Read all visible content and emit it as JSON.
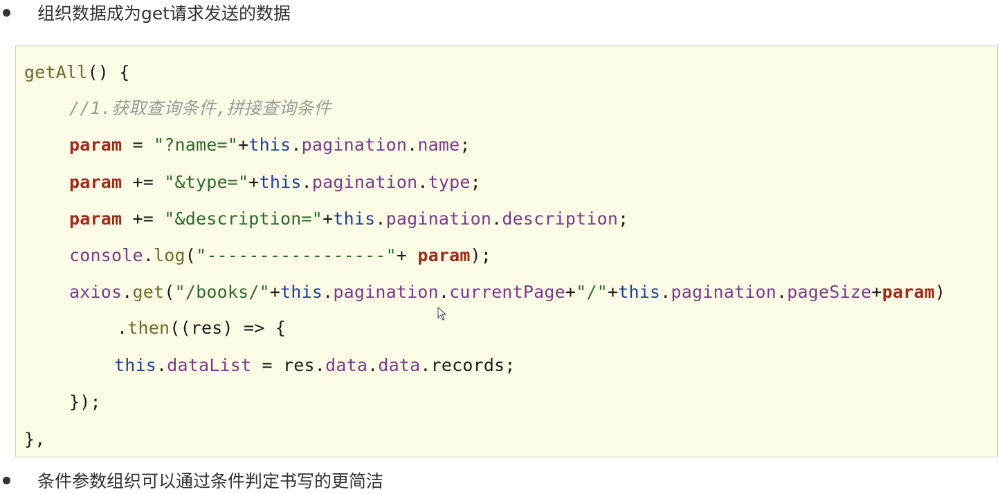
{
  "bullets": [
    {
      "text": "组织数据成为get请求发送的数据"
    },
    {
      "text": "条件参数组织可以通过条件判定书写的更简洁"
    }
  ],
  "code": {
    "lines": [
      [
        {
          "t": "fn",
          "v": "getAll"
        },
        {
          "t": "plain",
          "v": "() {"
        }
      ],
      [
        {
          "t": "comment",
          "v": "//1.获取查询条件,拼接查询条件"
        }
      ],
      [
        {
          "t": "var",
          "v": "param"
        },
        {
          "t": "plain",
          "v": " = "
        },
        {
          "t": "str",
          "v": "\"?name=\""
        },
        {
          "t": "plain",
          "v": "+"
        },
        {
          "t": "kw",
          "v": "this"
        },
        {
          "t": "plain",
          "v": "."
        },
        {
          "t": "prop",
          "v": "pagination"
        },
        {
          "t": "plain",
          "v": "."
        },
        {
          "t": "prop",
          "v": "name"
        },
        {
          "t": "plain",
          "v": ";"
        }
      ],
      [
        {
          "t": "var",
          "v": "param"
        },
        {
          "t": "plain",
          "v": " += "
        },
        {
          "t": "str",
          "v": "\"&type=\""
        },
        {
          "t": "plain",
          "v": "+"
        },
        {
          "t": "kw",
          "v": "this"
        },
        {
          "t": "plain",
          "v": "."
        },
        {
          "t": "prop",
          "v": "pagination"
        },
        {
          "t": "plain",
          "v": "."
        },
        {
          "t": "prop",
          "v": "type"
        },
        {
          "t": "plain",
          "v": ";"
        }
      ],
      [
        {
          "t": "var",
          "v": "param"
        },
        {
          "t": "plain",
          "v": " += "
        },
        {
          "t": "str",
          "v": "\"&description=\""
        },
        {
          "t": "plain",
          "v": "+"
        },
        {
          "t": "kw",
          "v": "this"
        },
        {
          "t": "plain",
          "v": "."
        },
        {
          "t": "prop",
          "v": "pagination"
        },
        {
          "t": "plain",
          "v": "."
        },
        {
          "t": "prop",
          "v": "description"
        },
        {
          "t": "plain",
          "v": ";"
        }
      ],
      [
        {
          "t": "prop",
          "v": "console"
        },
        {
          "t": "plain",
          "v": "."
        },
        {
          "t": "fn",
          "v": "log"
        },
        {
          "t": "plain",
          "v": "("
        },
        {
          "t": "str",
          "v": "\"-----------------\""
        },
        {
          "t": "plain",
          "v": "+ "
        },
        {
          "t": "var",
          "v": "param"
        },
        {
          "t": "plain",
          "v": ");"
        }
      ],
      [
        {
          "t": "prop",
          "v": "axios"
        },
        {
          "t": "plain",
          "v": "."
        },
        {
          "t": "fn",
          "v": "get"
        },
        {
          "t": "plain",
          "v": "("
        },
        {
          "t": "str",
          "v": "\"/books/\""
        },
        {
          "t": "plain",
          "v": "+"
        },
        {
          "t": "kw",
          "v": "this"
        },
        {
          "t": "plain",
          "v": "."
        },
        {
          "t": "prop",
          "v": "pagination"
        },
        {
          "t": "plain",
          "v": "."
        },
        {
          "t": "prop",
          "v": "currentPage"
        },
        {
          "t": "plain",
          "v": "+"
        },
        {
          "t": "str",
          "v": "\"/\""
        },
        {
          "t": "plain",
          "v": "+"
        },
        {
          "t": "kw",
          "v": "this"
        },
        {
          "t": "plain",
          "v": "."
        },
        {
          "t": "prop",
          "v": "pagination"
        },
        {
          "t": "plain",
          "v": "."
        },
        {
          "t": "prop",
          "v": "pageSize"
        },
        {
          "t": "plain",
          "v": "+"
        },
        {
          "t": "var",
          "v": "param"
        },
        {
          "t": "plain",
          "v": ")"
        }
      ],
      [
        {
          "t": "plain",
          "v": "."
        },
        {
          "t": "fn",
          "v": "then"
        },
        {
          "t": "plain",
          "v": "((res) => {"
        }
      ],
      [
        {
          "t": "kw",
          "v": "this"
        },
        {
          "t": "plain",
          "v": "."
        },
        {
          "t": "prop",
          "v": "dataList"
        },
        {
          "t": "plain",
          "v": " = res."
        },
        {
          "t": "prop",
          "v": "data"
        },
        {
          "t": "plain",
          "v": "."
        },
        {
          "t": "prop",
          "v": "data"
        },
        {
          "t": "plain",
          "v": ".records;"
        }
      ],
      [
        {
          "t": "plain",
          "v": "});"
        }
      ],
      [
        {
          "t": "plain",
          "v": "},"
        }
      ]
    ]
  },
  "colors": {
    "code_background": "#fdfde7",
    "variable": "#a02a1a",
    "string": "#2d6a2d",
    "keyword": "#1f3f9a",
    "property": "#7a3a8a",
    "function": "#6b6b2a",
    "comment": "#9a9a9a"
  },
  "icons": {
    "cursor": "mouse-pointer-icon"
  }
}
